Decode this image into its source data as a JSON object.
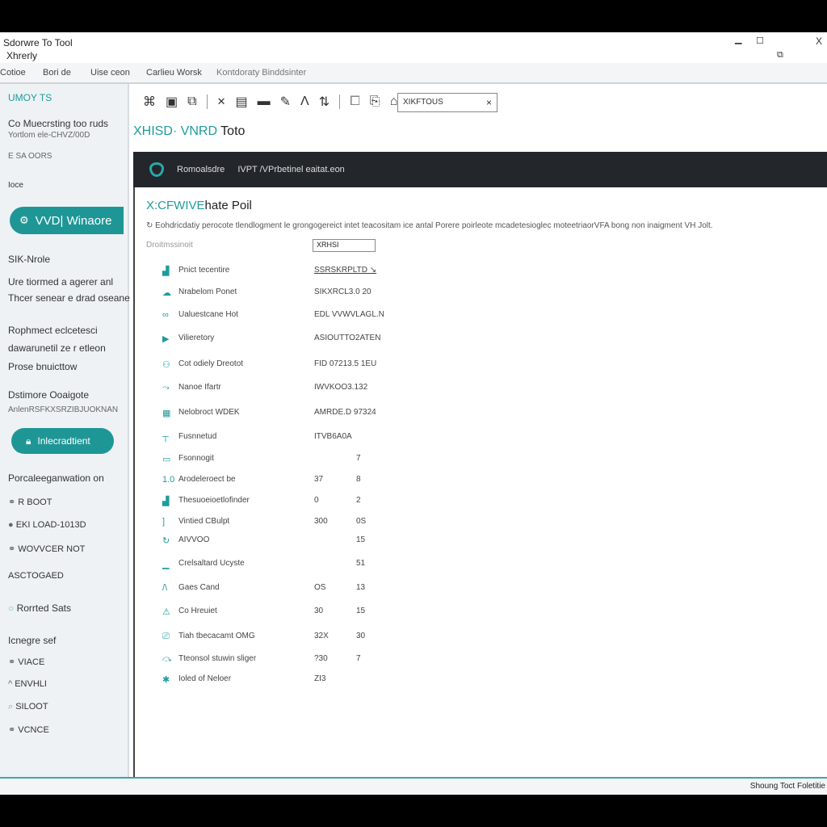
{
  "window": {
    "title": "Sdorwre To Tool",
    "subtitle": "Xhrerly",
    "minimize": "▁",
    "maximize": "☐",
    "close": "X",
    "restore": "⧉"
  },
  "menu": [
    "Cotioe",
    "Bori de",
    "Uise ceon",
    "Carlieu Worsk",
    "Kontdoraty Binddsinter"
  ],
  "sidebar": {
    "header": "UMOY TS",
    "intro_title": "Co Muecrsting too ruds",
    "intro_sub": "Yortlom ele-CHVZ/00D",
    "tag": "E SA OORS",
    "face": "Ioce",
    "primary_button": {
      "icon": "settings-icon",
      "label": "VVD| Winaore"
    },
    "section1": "SIK-Nrole",
    "line1": "Ure tiormed a agerer anl",
    "line2": "Thcer senear e drad oseane",
    "line3": "Rophmect eclcetesci",
    "line4": "dawarunetil ze r etleon",
    "line5": "Prose bnuicttow",
    "section2": "Dstimore Ooaigote",
    "section2_sub": "AnlenRSFKXSRZIBJUOKNAN",
    "action_button": {
      "icon": "lock-icon",
      "label": "Inlecradtient"
    },
    "section3": "Porcaleeganwation on",
    "items_a": [
      "R BOOT",
      "EKI LOAD-1013D",
      "WOVVCER NOT"
    ],
    "section4": "ASCTOGAED",
    "radio_label": "Rorrted Sats",
    "section5": "Icnegre sef",
    "items_b": [
      "VIACE",
      "ENVHLI",
      "SILOOT",
      "VCNCE"
    ]
  },
  "toolbar": {
    "search_value": "XIKFTOUS",
    "clear": "×"
  },
  "page": {
    "heading_accent": "XHISD· VNRD",
    "heading_rest": "Toto"
  },
  "banner": {
    "label": "Romoalsdre",
    "text": "IVPT /VPrbetinel eaitat.eon"
  },
  "panel": {
    "title_accent": "X:CFWIVE",
    "title_rest": "hate Poil",
    "description": "Eohdricdatiy perocote tlendlogment le grongogereict intet teacositam ice antal Porere poirleote mcadetesioglec moteetriaorVFA bong non inaigment VH Jolt.",
    "field_label": "Droitmssinoit",
    "field_value": "XRHSI",
    "rows": [
      {
        "icon": "chart-icon",
        "label": "Pnict tecentire",
        "v1": "SSRSKRPLTD  ↘",
        "v2": ""
      },
      {
        "icon": "cloud-icon",
        "label": "Nrabelom Ponet",
        "v1": "SIKXRCL3.0 20",
        "v2": ""
      },
      {
        "icon": "link-icon",
        "label": "Ualuestcane Hot",
        "v1": "EDL VVWVLAGL.N",
        "v2": ""
      },
      {
        "icon": "flag-icon",
        "label": "Vilieretory",
        "v1": "ASIOUTTO2ATEN",
        "v2": ""
      },
      {
        "icon": "users-icon",
        "label": "Cot odiely Dreotot",
        "v1": "FID 07213.5 1EU",
        "v2": ""
      },
      {
        "icon": "share-icon",
        "label": "Nanoe Ifartr",
        "v1": "IWVKOO3.132",
        "v2": ""
      },
      {
        "icon": "grid-icon",
        "label": "Nelobroct WDEK",
        "v1": "AMRDE.D 97324",
        "v2": ""
      },
      {
        "icon": "pin-icon",
        "label": "Fusnnetud",
        "v1": "ITVB6A0A",
        "v2": ""
      },
      {
        "icon": "image-icon",
        "label": "Fsonnogit",
        "v1": "",
        "v2": "7"
      },
      {
        "icon": "number-icon",
        "label": "Arodeleroect be",
        "v1": "37",
        "v2": "8"
      },
      {
        "icon": "chart-icon",
        "label": "Thesuoeioetlofinder",
        "v1": "0",
        "v2": "2"
      },
      {
        "icon": "bracket-icon",
        "label": "Vintied CBulpt",
        "v1": "300",
        "v2": "0S"
      },
      {
        "icon": "refresh-icon",
        "label": "AIVVOO",
        "v1": "",
        "v2": "15"
      },
      {
        "icon": "bar-icon",
        "label": "Crelsaltard Ucyste",
        "v1": "",
        "v2": "51"
      },
      {
        "icon": "pulse-icon",
        "label": "Gaes Cand",
        "v1": "OS",
        "v2": "13"
      },
      {
        "icon": "warning-icon",
        "label": "Co Hreuiet",
        "v1": "30",
        "v2": "15"
      },
      {
        "icon": "terminal-icon",
        "label": "Tiah tbecacamt OMG",
        "v1": "32X",
        "v2": "30"
      },
      {
        "icon": "arrow-icon",
        "label": "Tteonsol stuwin sliger",
        "v1": "?30",
        "v2": "7"
      },
      {
        "icon": "star-icon",
        "label": "Ioled of Neloer",
        "v1": "ZI3",
        "v2": ""
      }
    ]
  },
  "status": {
    "text": "Shoung Toct Foletitie"
  },
  "colors": {
    "accent": "#1f9696",
    "banner": "#23272b",
    "sidebar": "#eef2f5"
  }
}
